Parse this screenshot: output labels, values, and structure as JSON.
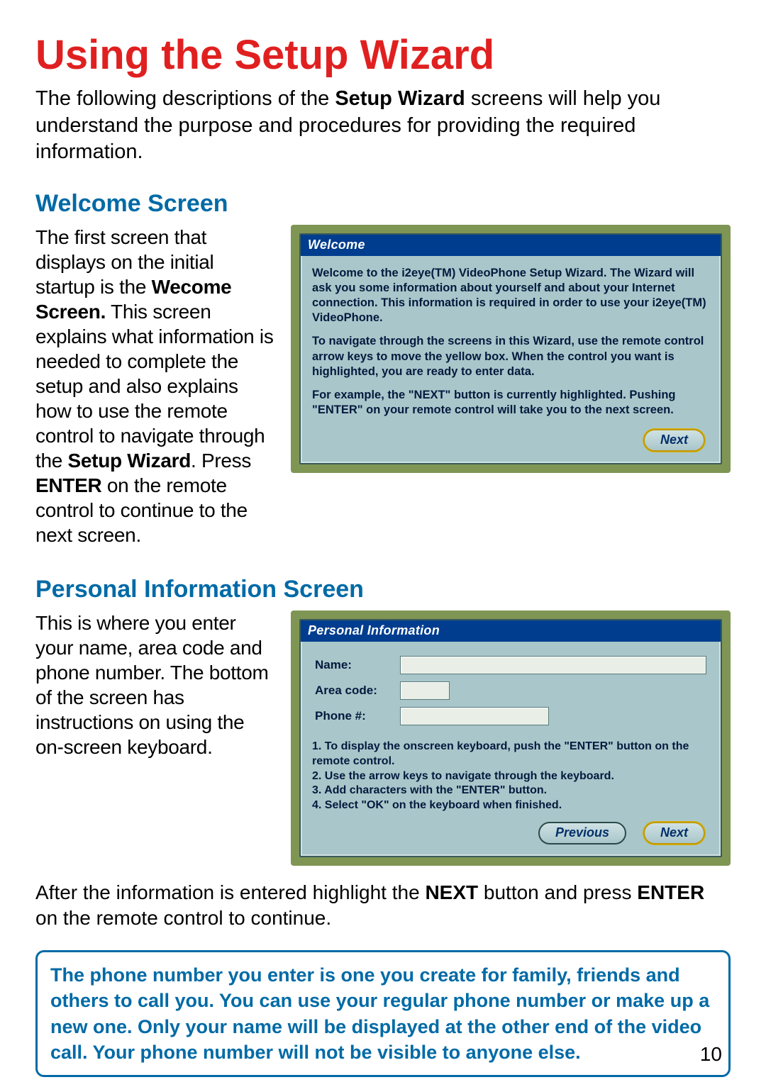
{
  "page": {
    "title": "Using the Setup Wizard",
    "intro_pre": "The following descriptions of the ",
    "intro_b": "Setup Wizard",
    "intro_post": " screens will help you understand the purpose and procedures for providing the required information.",
    "number": "10"
  },
  "section1": {
    "title": "Welcome Screen",
    "p1a": "The first screen that displays on the initial startup is the ",
    "p1b": "Wecome Screen.",
    "p1c": "  This screen explains what information is needed to complete the setup and also explains how to use the remote control to navigate through the ",
    "p1d": "Setup Wizard",
    "p1e": ".  Press ",
    "p1f": "ENTER",
    "p1g": " on the remote control to continue to the next screen."
  },
  "welcome": {
    "titlebar": "Welcome",
    "para1": "Welcome to the i2eye(TM) VideoPhone Setup Wizard. The Wizard will ask you some information about yourself and about your Internet connection. This information is required in order to use your i2eye(TM) VideoPhone.",
    "para2": "To navigate through the screens in this Wizard, use the remote control arrow keys to move the yellow box. When the control you want is highlighted, you are ready to enter data.",
    "para3": "For example, the \"NEXT\" button is currently highlighted. Pushing \"ENTER\" on your remote control will take you to the next screen.",
    "next": "Next"
  },
  "section2": {
    "title": "Personal Information Screen",
    "p1": "This is where you enter your name, area code and phone number.  The bottom of the screen has instructions on using the on-screen keyboard."
  },
  "personal": {
    "titlebar": "Personal Information",
    "labels": {
      "name": "Name:",
      "area": "Area code:",
      "phone": "Phone #:"
    },
    "instr1": "1. To display the onscreen keyboard, push the \"ENTER\" button on the remote control.",
    "instr2": "2. Use the arrow keys to navigate through the keyboard.",
    "instr3": "3. Add characters with the \"ENTER\" button.",
    "instr4": "4. Select \"OK\" on the keyboard when finished.",
    "previous": "Previous",
    "next": "Next"
  },
  "after": {
    "pre": "After the information is entered highlight the ",
    "b1": "NEXT",
    "mid": " button and press ",
    "b2": "ENTER",
    "post": " on the remote control to continue."
  },
  "callout": {
    "text": "The phone number you enter is one you create for family, friends and others to call you.  You can use your regular phone number or make up a new one.  Only your name will be displayed at the other end of the video call.  Your phone number will not be visible to anyone else."
  }
}
